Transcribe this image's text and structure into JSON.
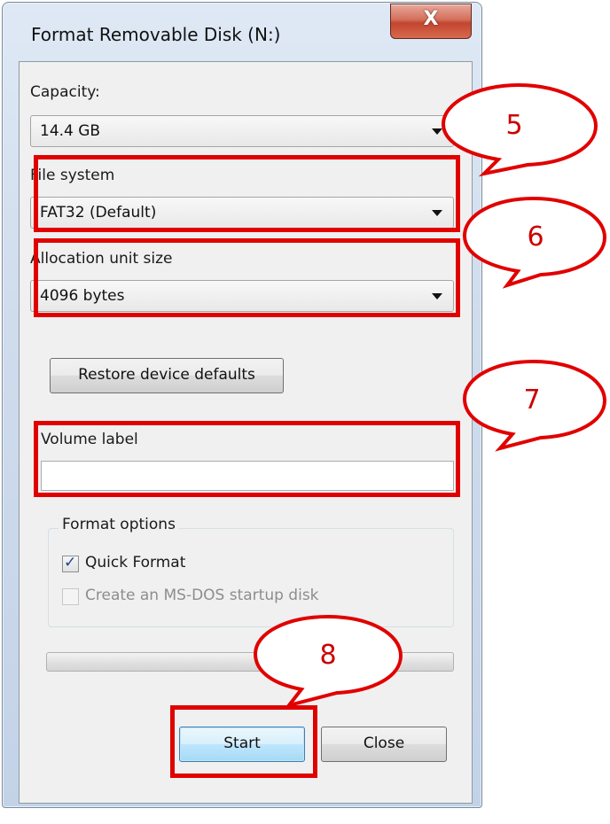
{
  "window": {
    "title": "Format Removable Disk (N:)",
    "close_glyph": "X"
  },
  "capacity": {
    "label": "Capacity:",
    "value": "14.4 GB"
  },
  "file_system": {
    "label": "File system",
    "value": "FAT32 (Default)"
  },
  "allocation": {
    "label": "Allocation unit size",
    "value": "4096 bytes"
  },
  "restore_button": "Restore device defaults",
  "volume_label": {
    "label": "Volume label",
    "value": ""
  },
  "format_options": {
    "title": "Format options",
    "quick_format": {
      "label": "Quick Format",
      "checked": true
    },
    "msdos_startup": {
      "label": "Create an MS-DOS startup disk",
      "checked": false,
      "enabled": false
    }
  },
  "progress": {
    "value": 0
  },
  "buttons": {
    "start": "Start",
    "close": "Close"
  },
  "annotations": {
    "callout_5": "5",
    "callout_6": "6",
    "callout_7": "7",
    "callout_8": "8",
    "highlight_color": "#e10000"
  }
}
